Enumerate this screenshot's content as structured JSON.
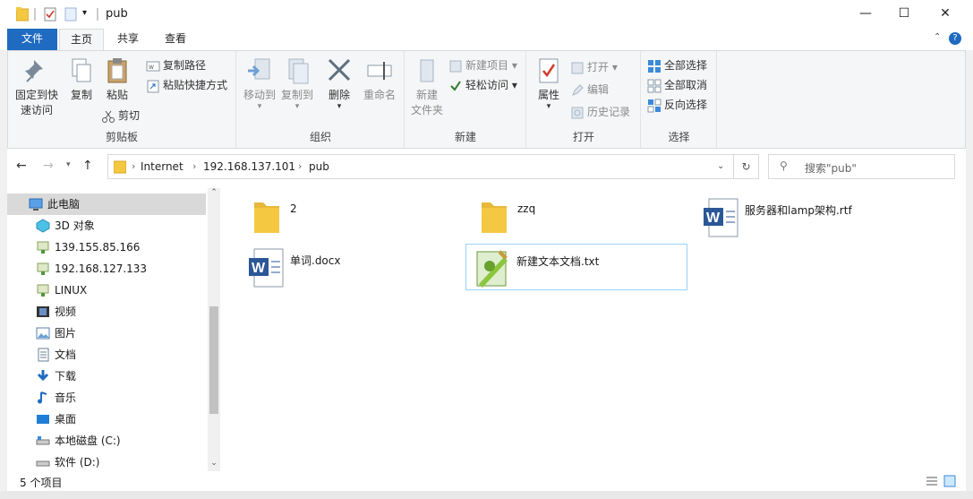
{
  "window": {
    "title": "pub",
    "minimize": "—",
    "maximize": "☐",
    "close": "✕"
  },
  "tabs": [
    "文件",
    "主页",
    "共享",
    "查看"
  ],
  "ribbon": {
    "clipboard": {
      "label": "剪贴板",
      "pin_line1": "固定到快",
      "pin_line2": "速访问",
      "copy": "复制",
      "paste": "粘贴",
      "copy_path": "复制路径",
      "paste_shortcut": "粘贴快捷方式",
      "cut": "剪切"
    },
    "organize": {
      "label": "组织",
      "move_to": "移动到",
      "copy_to": "复制到",
      "delete": "删除",
      "rename": "重命名"
    },
    "new": {
      "label": "新建",
      "new_folder_line1": "新建",
      "new_folder_line2": "文件夹",
      "new_item": "新建项目",
      "easy_access": "轻松访问"
    },
    "open": {
      "label": "打开",
      "properties": "属性",
      "open": "打开",
      "edit": "编辑",
      "history": "历史记录"
    },
    "select": {
      "label": "选择",
      "select_all": "全部选择",
      "select_none": "全部取消",
      "invert": "反向选择"
    }
  },
  "address": {
    "crumbs": [
      "Internet",
      "192.168.137.101",
      "pub"
    ],
    "search_placeholder": "搜索\"pub\""
  },
  "nav": [
    {
      "label": "此电脑",
      "icon": "pc-icon",
      "selected": true,
      "level": 0
    },
    {
      "label": "3D 对象",
      "icon": "3d-objects-icon",
      "level": 1
    },
    {
      "label": "139.155.85.166",
      "icon": "network-drive-icon",
      "level": 1
    },
    {
      "label": "192.168.127.133",
      "icon": "network-drive-icon",
      "level": 1
    },
    {
      "label": "LINUX",
      "icon": "network-drive-icon",
      "level": 1
    },
    {
      "label": "视频",
      "icon": "video-icon",
      "level": 1
    },
    {
      "label": "图片",
      "icon": "pictures-icon",
      "level": 1
    },
    {
      "label": "文档",
      "icon": "documents-icon",
      "level": 1
    },
    {
      "label": "下载",
      "icon": "download-icon",
      "level": 1
    },
    {
      "label": "音乐",
      "icon": "music-icon",
      "level": 1
    },
    {
      "label": "桌面",
      "icon": "desktop-icon",
      "level": 1
    },
    {
      "label": "本地磁盘 (C:)",
      "icon": "local-disk-icon",
      "level": 1
    },
    {
      "label": "软件 (D:)",
      "icon": "disk-icon",
      "level": 1
    }
  ],
  "files": [
    {
      "name": "2",
      "icon": "folder-icon"
    },
    {
      "name": "zzq",
      "icon": "folder-icon"
    },
    {
      "name": "服务器和lamp架构.rtf",
      "icon": "word-icon"
    },
    {
      "name": "单词.docx",
      "icon": "word-icon"
    },
    {
      "name": "新建文本文档.txt",
      "icon": "notepad-plus-icon"
    }
  ],
  "status": {
    "count": "5 个项目"
  },
  "colors": {
    "accent": "#1f6bc1",
    "selection": "#cce8ff",
    "folder": "#f5c842"
  }
}
